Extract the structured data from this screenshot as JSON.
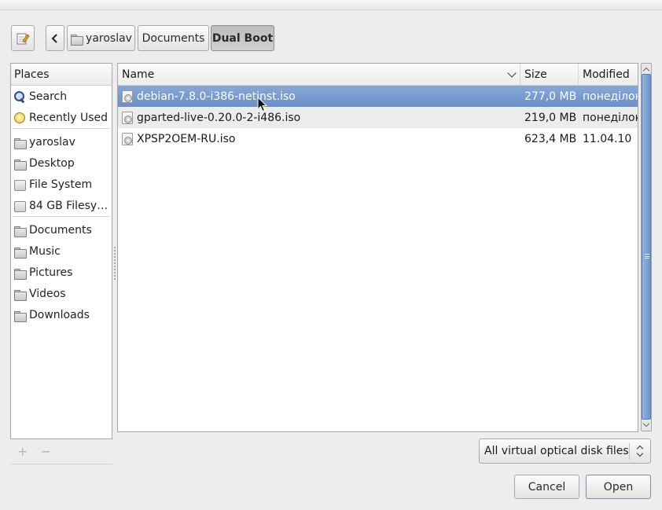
{
  "path_bar": {
    "crumbs": [
      "yaroslav",
      "Documents",
      "Dual Boot"
    ],
    "active_crumb": "Dual Boot"
  },
  "places": {
    "header": "Places",
    "items": [
      {
        "label": "Search",
        "icon": "search-icon"
      },
      {
        "label": "Recently Used",
        "icon": "recent-icon"
      },
      {
        "label": "yaroslav",
        "icon": "home-folder-icon"
      },
      {
        "label": "Desktop",
        "icon": "desktop-folder-icon"
      },
      {
        "label": "File System",
        "icon": "drive-icon"
      },
      {
        "label": "84 GB Filesy…",
        "icon": "drive-icon"
      },
      {
        "label": "Documents",
        "icon": "documents-folder-icon"
      },
      {
        "label": "Music",
        "icon": "music-folder-icon"
      },
      {
        "label": "Pictures",
        "icon": "pictures-folder-icon"
      },
      {
        "label": "Videos",
        "icon": "videos-folder-icon"
      },
      {
        "label": "Downloads",
        "icon": "downloads-folder-icon"
      }
    ],
    "add_symbol": "+",
    "remove_symbol": "−"
  },
  "files": {
    "columns": {
      "name": "Name",
      "size": "Size",
      "modified": "Modified"
    },
    "rows": [
      {
        "name": "debian-7.8.0-i386-netinst.iso",
        "size": "277,0 MB",
        "modified": "понеділок",
        "selected": true
      },
      {
        "name": "gparted-live-0.20.0-2-i486.iso",
        "size": "219,0 MB",
        "modified": "понеділок",
        "selected": false
      },
      {
        "name": "XPSP2OEM-RU.iso",
        "size": "623,4 MB",
        "modified": "11.04.10",
        "selected": false
      }
    ]
  },
  "filter": {
    "selected": "All virtual optical disk files"
  },
  "actions": {
    "cancel": "Cancel",
    "open": "Open"
  },
  "colors": {
    "selection": "#7a9cd0",
    "background": "#ededed",
    "scroll_thumb": "#7f9fd4"
  }
}
